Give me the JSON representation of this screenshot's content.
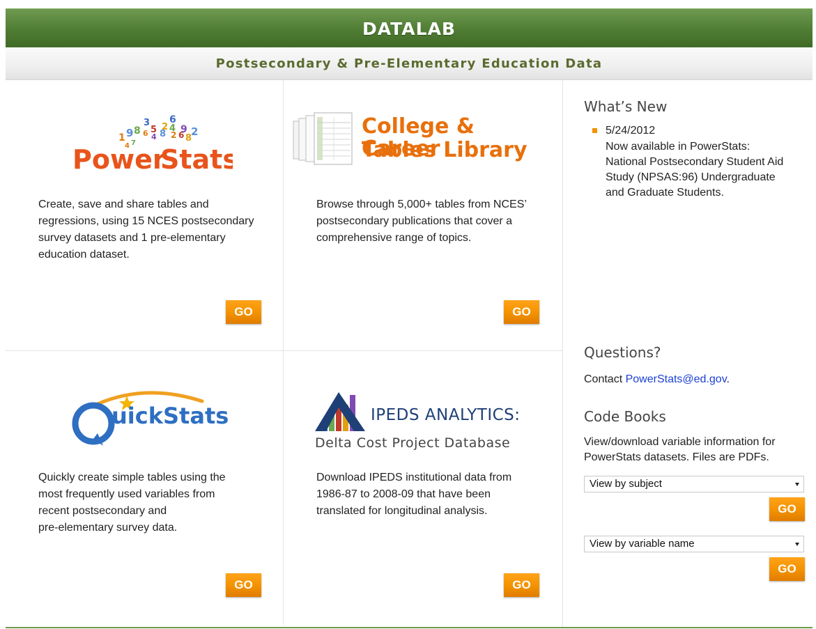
{
  "header": {
    "title": "DATALAB",
    "subtitle": "Postsecondary & Pre-Elementary Education Data"
  },
  "tiles": [
    {
      "logo_text": "PowerStats",
      "logo_digits": "1 9 8 3 5 2 4 9 2 6 6 4 8 2 6 8 2 7 4",
      "description": "Create, save and share tables and regressions, using 15 NCES postsecondary survey datasets and 1 pre-elementary education dataset.",
      "go_label": "GO"
    },
    {
      "logo_line1": "College & Career",
      "logo_line2": "Tables Library",
      "description": "Browse through 5,000+ tables from NCES’ postsecondary publications that cover a comprehensive range of topics.",
      "go_label": "GO"
    },
    {
      "logo_q": "Q",
      "logo_text": "uickStats",
      "description_lines": [
        "Quickly create simple tables using the",
        "most frequently used variables from",
        "recent postsecondary and",
        "pre-elementary survey data."
      ],
      "go_label": "GO"
    },
    {
      "logo_line1": "IPEDS ANALYTICS:",
      "logo_line2": "Delta Cost Project Database",
      "description": "Download IPEDS institutional data from 1986-87 to 2008-09 that have been translated for longitudinal analysis.",
      "go_label": "GO"
    }
  ],
  "whats_new": {
    "heading": "What’s New",
    "date": "5/24/2012",
    "text": "Now available in PowerStats: National Postsecondary Student Aid Study (NPSAS:96) Undergraduate and Graduate Students."
  },
  "questions": {
    "heading": "Questions?",
    "prefix": "Contact ",
    "email": "PowerStats@ed.gov",
    "suffix": "."
  },
  "code_books": {
    "heading": "Code Books",
    "text": "View/download variable information for PowerStats datasets. Files are PDFs.",
    "select1": "View by subject",
    "select2": "View by variable name",
    "go_label": "GO"
  },
  "colors": {
    "header_green": "#4f7c33",
    "subtitle_olive": "#5b6a2e",
    "go_orange": "#f39200",
    "link_blue": "#1a3fd6"
  }
}
